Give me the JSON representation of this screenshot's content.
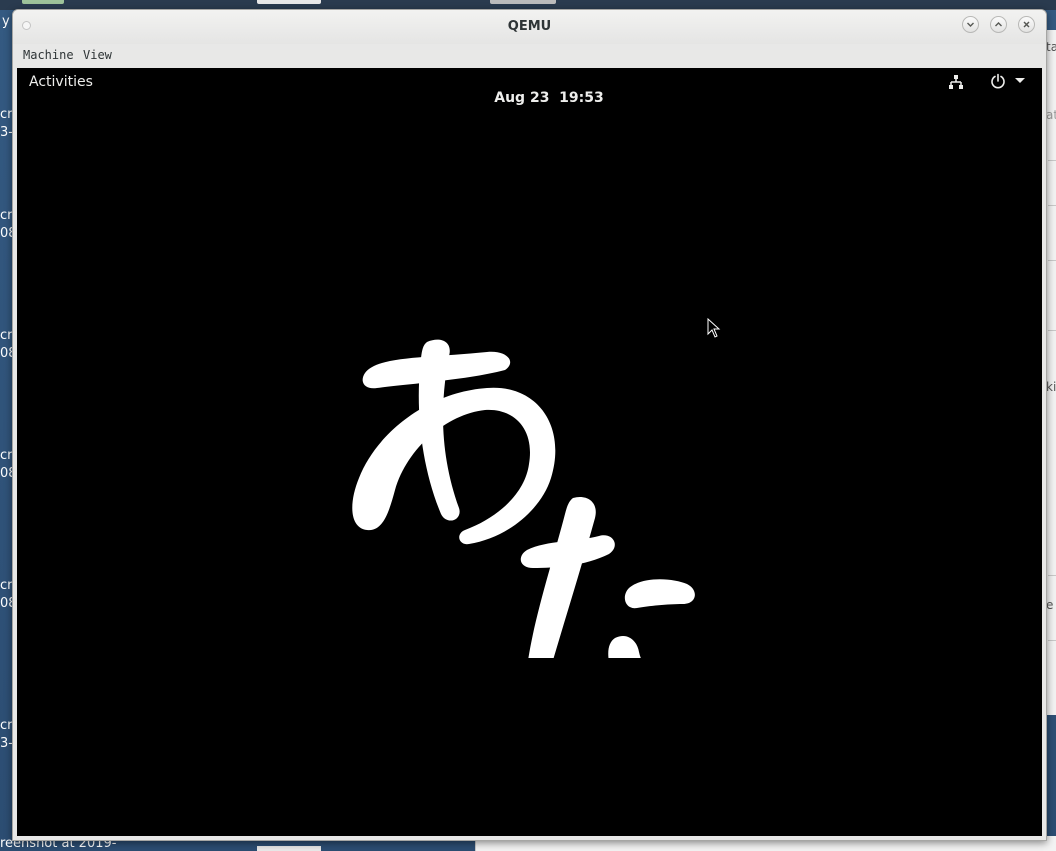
{
  "window": {
    "title": "QEMU"
  },
  "menubar": {
    "items": [
      {
        "label": "Machine"
      },
      {
        "label": "View"
      }
    ]
  },
  "guest": {
    "topbar": {
      "activities_label": "Activities",
      "clock": "Aug 23  19:53"
    },
    "center_text": "あた"
  },
  "background": {
    "left_labels": [
      "y",
      "cr",
      "3-",
      "cr",
      "08",
      "cr",
      "08",
      "cr",
      "08",
      "cre",
      "08",
      "cre",
      "3-"
    ],
    "bottom_label": "reenshot at 2019-",
    "right_snippets": [
      "ta",
      "at",
      "kin",
      "e r"
    ]
  },
  "icons": {
    "network": "network-wired-icon",
    "power": "power-icon",
    "menu_arrow": "dropdown-arrow-icon",
    "minimize": "minimize-icon",
    "maximize": "maximize-icon",
    "close": "close-icon"
  },
  "colors": {
    "guest_background": "#000000",
    "guest_text": "#eeeeec",
    "glyph_color": "#ffffff",
    "titlebar": "#ebebea",
    "desktop": "#2f5078"
  }
}
